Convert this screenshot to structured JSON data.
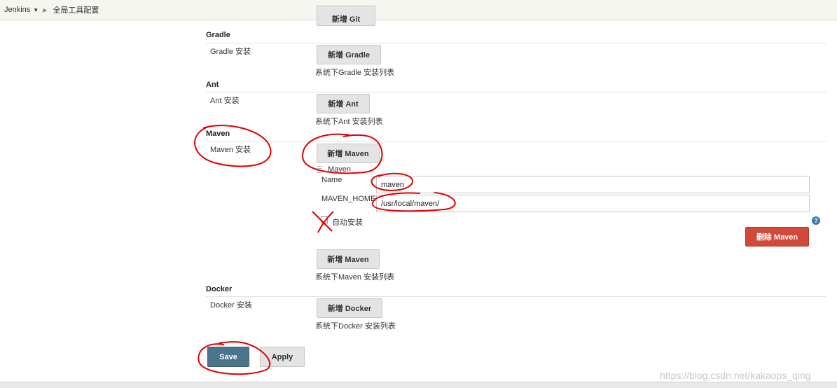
{
  "breadcrumb": {
    "root": "Jenkins",
    "current": "全局工具配置"
  },
  "top_clipped_button": "新增 Git",
  "gradle": {
    "title": "Gradle",
    "label": "Gradle 安装",
    "add_button": "新增 Gradle",
    "hint": "系统下Gradle 安装列表"
  },
  "ant": {
    "title": "Ant",
    "label": "Ant 安装",
    "add_button": "新增 Ant",
    "hint": "系统下Ant 安装列表"
  },
  "maven": {
    "title": "Maven",
    "label": "Maven 安装",
    "add_button": "新增 Maven",
    "entry_title": "Maven",
    "name_label": "Name",
    "name_value": "maven",
    "home_label": "MAVEN_HOME",
    "home_value": "/usr/local/maven/",
    "auto_install_label": "自动安装",
    "auto_install_checked": false,
    "delete_button": "删除 Maven",
    "add_button_bottom": "新增 Maven",
    "hint": "系统下Maven 安装列表",
    "help_icon": "?"
  },
  "docker": {
    "title": "Docker",
    "label": "Docker 安装",
    "add_button": "新增 Docker",
    "hint": "系统下Docker 安装列表"
  },
  "actions": {
    "save": "Save",
    "apply": "Apply"
  },
  "watermark": "https://blog.csdn.net/kakaops_qing",
  "colors": {
    "danger": "#d24939",
    "primary": "#4b758b",
    "annotation": "#e00000"
  }
}
